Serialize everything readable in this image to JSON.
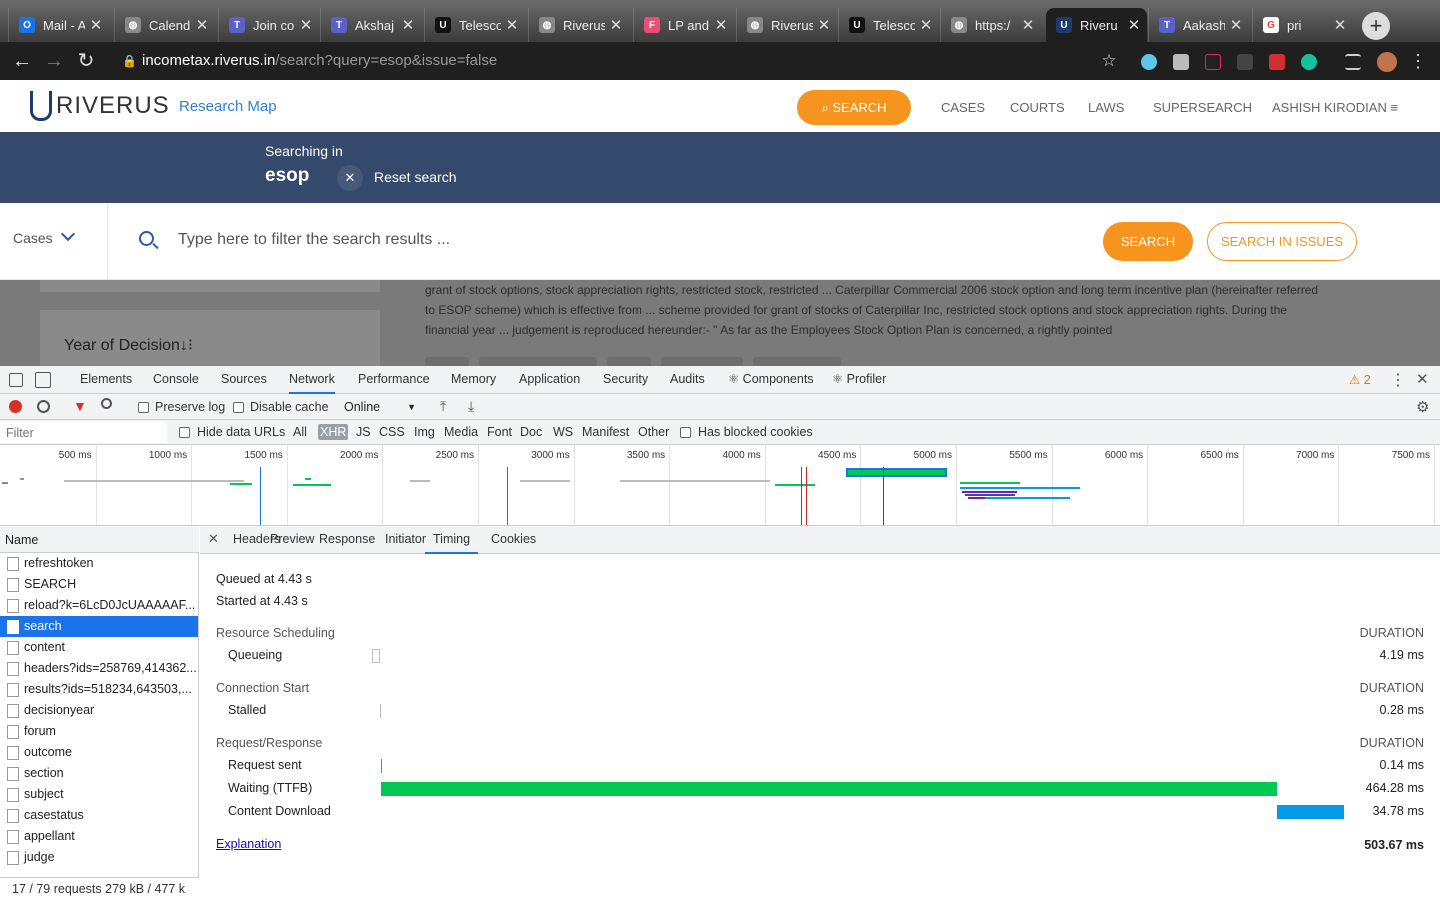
{
  "browser": {
    "tabs": [
      {
        "title": "Mail - A",
        "favicon": "outlook-icon",
        "color": "#1a73e8",
        "glyph": "O"
      },
      {
        "title": "Calend",
        "favicon": "globe-icon",
        "color": "#888888",
        "glyph": "◍"
      },
      {
        "title": "Join co",
        "favicon": "teams-icon",
        "color": "#5b5fc7",
        "glyph": "T"
      },
      {
        "title": "Akshaj",
        "favicon": "teams-icon",
        "color": "#5b5fc7",
        "glyph": "T"
      },
      {
        "title": "Telesco",
        "favicon": "telescope-icon",
        "color": "#111111",
        "glyph": "U"
      },
      {
        "title": "Riverus",
        "favicon": "globe-icon",
        "color": "#888888",
        "glyph": "◍"
      },
      {
        "title": "LP and",
        "favicon": "figma-icon",
        "color": "#e94e77",
        "glyph": "F"
      },
      {
        "title": "Riverus",
        "favicon": "globe-icon",
        "color": "#888888",
        "glyph": "◍"
      },
      {
        "title": "Telesco",
        "favicon": "telescope-icon",
        "color": "#111111",
        "glyph": "U"
      },
      {
        "title": "https:/",
        "favicon": "globe-icon",
        "color": "#888888",
        "glyph": "◍"
      },
      {
        "title": "Riveru",
        "favicon": "riverus-icon",
        "color": "#1f3b6b",
        "glyph": "U"
      },
      {
        "title": "Aakash",
        "favicon": "teams-icon",
        "color": "#5b5fc7",
        "glyph": "T"
      },
      {
        "title": "pri",
        "favicon": "google-icon",
        "color": "#ffffff",
        "glyph": "G"
      }
    ],
    "active_tab_index": 10,
    "url_host": "incometax.riverus.in",
    "url_path": "/search?query=esop&issue=false"
  },
  "site": {
    "logo_text": "RIVERUS",
    "subtitle": "Research Map",
    "nav": {
      "search": "SEARCH",
      "cases": "CASES",
      "courts": "COURTS",
      "laws": "LAWS",
      "supersearch": "SUPERSEARCH",
      "user": "ASHISH KIRODIAN"
    },
    "banner": {
      "searching_in": "Searching in",
      "query": "esop",
      "reset": "Reset search"
    },
    "filter": {
      "scope": "Cases",
      "placeholder": "Type here to filter the search results ...",
      "search_btn": "SEARCH",
      "issues_btn": "SEARCH IN ISSUES"
    },
    "year_of_decision": "Year of Decision",
    "snippet": "grant of stock options, stock appreciation rights, restricted stock, restricted ... Caterpillar Commercial 2006 stock option and long term incentive plan (hereinafter referred to ESOP scheme) which is effective from ... scheme provided for grant of stocks of Caterpillar Inc, restricted stock options and stock appreciation rights. During the financial year ... judgement is reproduced hereunder:- \" As far as the Employees Stock Option Plan is concerned, a rightly pointed"
  },
  "devtools": {
    "tabs": [
      "Elements",
      "Console",
      "Sources",
      "Network",
      "Performance",
      "Memory",
      "Application",
      "Security",
      "Audits",
      "⚛ Components",
      "⚛ Profiler"
    ],
    "active_tab": "Network",
    "warnings": "2",
    "toolbar": {
      "preserve_log": "Preserve log",
      "disable_cache": "Disable cache",
      "throttle": "Online"
    },
    "filterbar": {
      "placeholder": "Filter",
      "hide_data_urls": "Hide data URLs",
      "types": [
        "All",
        "XHR",
        "JS",
        "CSS",
        "Img",
        "Media",
        "Font",
        "Doc",
        "WS",
        "Manifest",
        "Other"
      ],
      "active_type": "XHR",
      "blocked": "Has blocked cookies"
    },
    "overview_ticks": [
      "500 ms",
      "1000 ms",
      "1500 ms",
      "2000 ms",
      "2500 ms",
      "3000 ms",
      "3500 ms",
      "4000 ms",
      "4500 ms",
      "5000 ms",
      "5500 ms",
      "6000 ms",
      "6500 ms",
      "7000 ms",
      "7500 ms"
    ],
    "name_header": "Name",
    "requests": [
      "refreshtoken",
      "SEARCH",
      "reload?k=6LcD0JcUAAAAAF...",
      "search",
      "content",
      "headers?ids=258769,414362...",
      "results?ids=518234,643503,...",
      "decisionyear",
      "forum",
      "outcome",
      "section",
      "subject",
      "casestatus",
      "appellant",
      "judge"
    ],
    "selected_request": "search",
    "summary": "17 / 79 requests   279 kB / 477 k",
    "detail_tabs": [
      "Headers",
      "Preview",
      "Response",
      "Initiator",
      "Timing",
      "Cookies"
    ],
    "active_detail_tab": "Timing",
    "timing": {
      "queued": "Queued at 4.43 s",
      "started": "Started at 4.43 s",
      "duration_label": "DURATION",
      "sections": [
        {
          "title": "Resource Scheduling",
          "rows": [
            {
              "label": "Queueing",
              "value": "4.19 ms",
              "ms": 4.19,
              "color": "#ffffff"
            }
          ]
        },
        {
          "title": "Connection Start",
          "rows": [
            {
              "label": "Stalled",
              "value": "0.28 ms",
              "ms": 0.28,
              "color": "#bbbbbb"
            }
          ]
        },
        {
          "title": "Request/Response",
          "rows": [
            {
              "label": "Request sent",
              "value": "0.14 ms",
              "ms": 0.14,
              "color": "#00c853"
            },
            {
              "label": "Waiting (TTFB)",
              "value": "464.28 ms",
              "ms": 464.28,
              "color": "#00c853"
            },
            {
              "label": "Content Download",
              "value": "34.78 ms",
              "ms": 34.78,
              "color": "#039be5"
            }
          ]
        }
      ],
      "explanation": "Explanation",
      "total": "503.67 ms"
    }
  }
}
